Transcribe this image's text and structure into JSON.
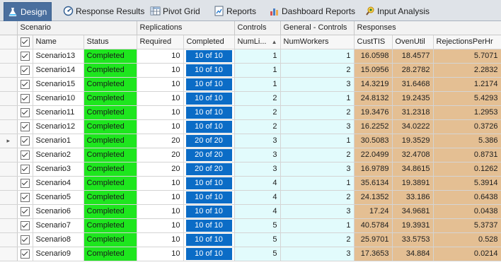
{
  "tabs": [
    {
      "label": "Design",
      "icon": "flask-icon",
      "active": true
    },
    {
      "label": "Response Results",
      "icon": "gauge-icon",
      "active": false
    },
    {
      "label": "Pivot Grid",
      "icon": "pivot-grid-icon",
      "active": false
    },
    {
      "label": "Reports",
      "icon": "report-chart-icon",
      "active": false
    },
    {
      "label": "Dashboard Reports",
      "icon": "dashboard-bar-chart-icon",
      "active": false
    },
    {
      "label": "Input Analysis",
      "icon": "input-analysis-icon",
      "active": false
    }
  ],
  "groups": {
    "scenario": "Scenario",
    "replications": "Replications",
    "controls": "Controls",
    "general_controls": "General - Controls",
    "responses": "Responses"
  },
  "columns": {
    "name": "Name",
    "status": "Status",
    "required": "Required",
    "completed": "Completed",
    "num_lines": "NumLi...",
    "num_workers": "NumWorkers",
    "cust_tis": "CustTIS",
    "oven_util": "OvenUtil",
    "rejections": "RejectionsPerHr"
  },
  "rows": [
    {
      "name": "Scenario13",
      "status": "Completed",
      "required": "10",
      "completed": "10 of 10",
      "num_lines": "1",
      "num_workers": "1",
      "cust_tis": "16.0598",
      "oven_util": "18.4577",
      "rejections": "5.7071",
      "current": false
    },
    {
      "name": "Scenario14",
      "status": "Completed",
      "required": "10",
      "completed": "10 of 10",
      "num_lines": "1",
      "num_workers": "2",
      "cust_tis": "15.0956",
      "oven_util": "28.2782",
      "rejections": "2.2832",
      "current": false
    },
    {
      "name": "Scenario15",
      "status": "Completed",
      "required": "10",
      "completed": "10 of 10",
      "num_lines": "1",
      "num_workers": "3",
      "cust_tis": "14.3219",
      "oven_util": "31.6468",
      "rejections": "1.2174",
      "current": false
    },
    {
      "name": "Scenario10",
      "status": "Completed",
      "required": "10",
      "completed": "10 of 10",
      "num_lines": "2",
      "num_workers": "1",
      "cust_tis": "24.8132",
      "oven_util": "19.2435",
      "rejections": "5.4293",
      "current": false
    },
    {
      "name": "Scenario11",
      "status": "Completed",
      "required": "10",
      "completed": "10 of 10",
      "num_lines": "2",
      "num_workers": "2",
      "cust_tis": "19.3476",
      "oven_util": "31.2318",
      "rejections": "1.2953",
      "current": false
    },
    {
      "name": "Scenario12",
      "status": "Completed",
      "required": "10",
      "completed": "10 of 10",
      "num_lines": "2",
      "num_workers": "3",
      "cust_tis": "16.2252",
      "oven_util": "34.0222",
      "rejections": "0.3726",
      "current": false
    },
    {
      "name": "Scenario1",
      "status": "Completed",
      "required": "20",
      "completed": "20 of 20",
      "num_lines": "3",
      "num_workers": "1",
      "cust_tis": "30.5083",
      "oven_util": "19.3529",
      "rejections": "5.386",
      "current": true
    },
    {
      "name": "Scenario2",
      "status": "Completed",
      "required": "20",
      "completed": "20 of 20",
      "num_lines": "3",
      "num_workers": "2",
      "cust_tis": "22.0499",
      "oven_util": "32.4708",
      "rejections": "0.8731",
      "current": false
    },
    {
      "name": "Scenario3",
      "status": "Completed",
      "required": "20",
      "completed": "20 of 20",
      "num_lines": "3",
      "num_workers": "3",
      "cust_tis": "16.9789",
      "oven_util": "34.8615",
      "rejections": "0.1262",
      "current": false
    },
    {
      "name": "Scenario4",
      "status": "Completed",
      "required": "10",
      "completed": "10 of 10",
      "num_lines": "4",
      "num_workers": "1",
      "cust_tis": "35.6134",
      "oven_util": "19.3891",
      "rejections": "5.3914",
      "current": false
    },
    {
      "name": "Scenario5",
      "status": "Completed",
      "required": "10",
      "completed": "10 of 10",
      "num_lines": "4",
      "num_workers": "2",
      "cust_tis": "24.1352",
      "oven_util": "33.186",
      "rejections": "0.6438",
      "current": false
    },
    {
      "name": "Scenario6",
      "status": "Completed",
      "required": "10",
      "completed": "10 of 10",
      "num_lines": "4",
      "num_workers": "3",
      "cust_tis": "17.24",
      "oven_util": "34.9681",
      "rejections": "0.0438",
      "current": false
    },
    {
      "name": "Scenario7",
      "status": "Completed",
      "required": "10",
      "completed": "10 of 10",
      "num_lines": "5",
      "num_workers": "1",
      "cust_tis": "40.5784",
      "oven_util": "19.3931",
      "rejections": "5.3737",
      "current": false
    },
    {
      "name": "Scenario8",
      "status": "Completed",
      "required": "10",
      "completed": "10 of 10",
      "num_lines": "5",
      "num_workers": "2",
      "cust_tis": "25.9701",
      "oven_util": "33.5753",
      "rejections": "0.528",
      "current": false
    },
    {
      "name": "Scenario9",
      "status": "Completed",
      "required": "10",
      "completed": "10 of 10",
      "num_lines": "5",
      "num_workers": "3",
      "cust_tis": "17.3653",
      "oven_util": "34.884",
      "rejections": "0.0214",
      "current": false
    }
  ],
  "colors": {
    "status_completed": "#1ee61e",
    "completed_pill": "#0b6cc6",
    "controls_bg": "#e2fbfc",
    "responses_bg": "#e4bf93",
    "active_tab": "#4a6f9e"
  }
}
